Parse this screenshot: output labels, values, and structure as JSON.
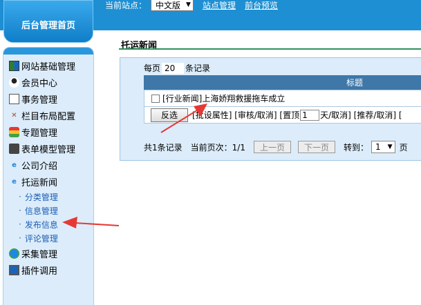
{
  "header": {
    "site_label": "当前站点：",
    "site_value": "中文版",
    "links": [
      "站点管理",
      "前台预览"
    ]
  },
  "home_button": "后台管理首页",
  "sidebar": {
    "items": [
      {
        "label": "网站基础管理",
        "icon": "grid-icon"
      },
      {
        "label": "会员中心",
        "icon": "user-icon"
      },
      {
        "label": "事务管理",
        "icon": "task-icon"
      },
      {
        "label": "栏目布局配置",
        "icon": "tools-icon"
      },
      {
        "label": "专题管理",
        "icon": "topic-icon"
      },
      {
        "label": "表单模型管理",
        "icon": "form-icon"
      },
      {
        "label": "公司介绍",
        "icon": "ie-icon"
      },
      {
        "label": "托运新闻",
        "icon": "ie-icon"
      }
    ],
    "subitems": [
      "分类管理",
      "信息管理",
      "发布信息",
      "评论管理"
    ],
    "bottom_items": [
      {
        "label": "采集管理",
        "icon": "globe-icon"
      },
      {
        "label": "插件调用",
        "icon": "computer-icon"
      }
    ]
  },
  "main": {
    "title": "托运新闻",
    "per_page_prefix": "每页",
    "per_page_value": "20",
    "per_page_suffix": "条记录",
    "column_title": "标题",
    "row_category": "[行业新闻]",
    "row_title": "上海娇翔救援拖车成立",
    "invert_button": "反选",
    "batch_text_1": "[批设属性] [审核/取消] [置顶",
    "days_value": "1",
    "batch_text_2": "天/取消] [推荐/取消] [",
    "pager": {
      "total": "共1条记录",
      "current": "当前页次：1/1",
      "prev": "上一页",
      "next": "下一页",
      "goto": "转到：",
      "page_value": "1",
      "page_unit": "页"
    }
  },
  "colors": {
    "header": "#1e8fd3",
    "panel": "#dcecfa",
    "table_header": "#3e77a8",
    "arrow": "#e53935"
  }
}
